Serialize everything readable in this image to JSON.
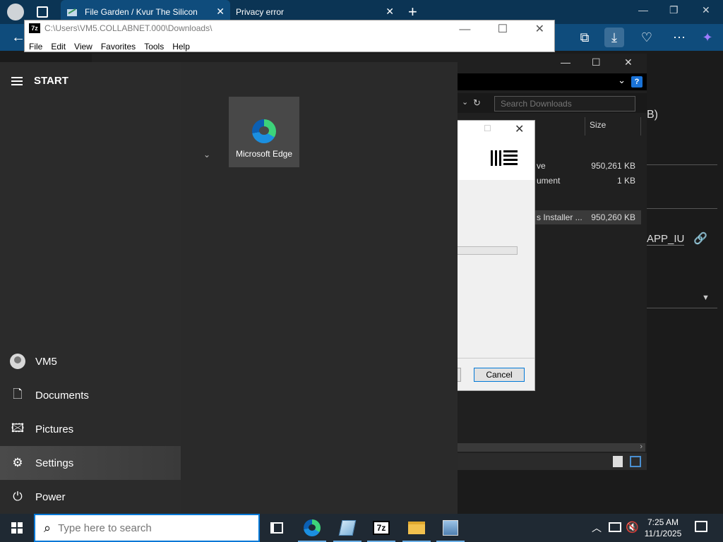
{
  "browser": {
    "tabs": [
      {
        "title": "File Garden / Kvur The Silicon",
        "active": true
      },
      {
        "title": "Privacy error",
        "active": false
      }
    ],
    "icons": [
      "profile-avatar",
      "tab-actions-icon",
      "new-tab-icon",
      "back-icon",
      "collections-icon",
      "downloads-icon",
      "health-icon",
      "more-icon",
      "copilot-icon"
    ],
    "page_fragments": {
      "size_text": "B)",
      "link_text": "APP_IU"
    },
    "accent": "#0f4c7c"
  },
  "sevenzip": {
    "title_path": "C:\\Users\\VM5.COLLABNET.000\\Downloads\\",
    "logo": "7z",
    "menu": [
      "File",
      "Edit",
      "View",
      "Favorites",
      "Tools",
      "Help"
    ]
  },
  "explorer": {
    "search_placeholder": "Search Downloads",
    "column_size": "Size",
    "files": [
      {
        "name": "ve",
        "size": "950,261 KB",
        "selected": false
      },
      {
        "name": "ument",
        "size": "1 KB",
        "selected": false
      },
      {
        "name": "s Installer ...",
        "size": "950,260 KB",
        "selected": true
      }
    ],
    "help_label": "?"
  },
  "dialog": {
    "cancel_label": "Cancel"
  },
  "startmenu": {
    "header": "START",
    "user": "VM5",
    "items": [
      {
        "label": "Documents",
        "icon": "document-icon"
      },
      {
        "label": "Pictures",
        "icon": "pictures-icon"
      },
      {
        "label": "Settings",
        "icon": "settings-icon"
      },
      {
        "label": "Power",
        "icon": "power-icon"
      }
    ],
    "tile": {
      "label": "Microsoft Edge",
      "icon": "edge-icon"
    }
  },
  "taskbar": {
    "search_placeholder": "Type here to search",
    "apps": [
      "task-view",
      "microsoft-edge",
      "notepad",
      "7-zip",
      "file-explorer",
      "installer"
    ],
    "time": "7:25 AM",
    "date": "11/1/2025"
  }
}
